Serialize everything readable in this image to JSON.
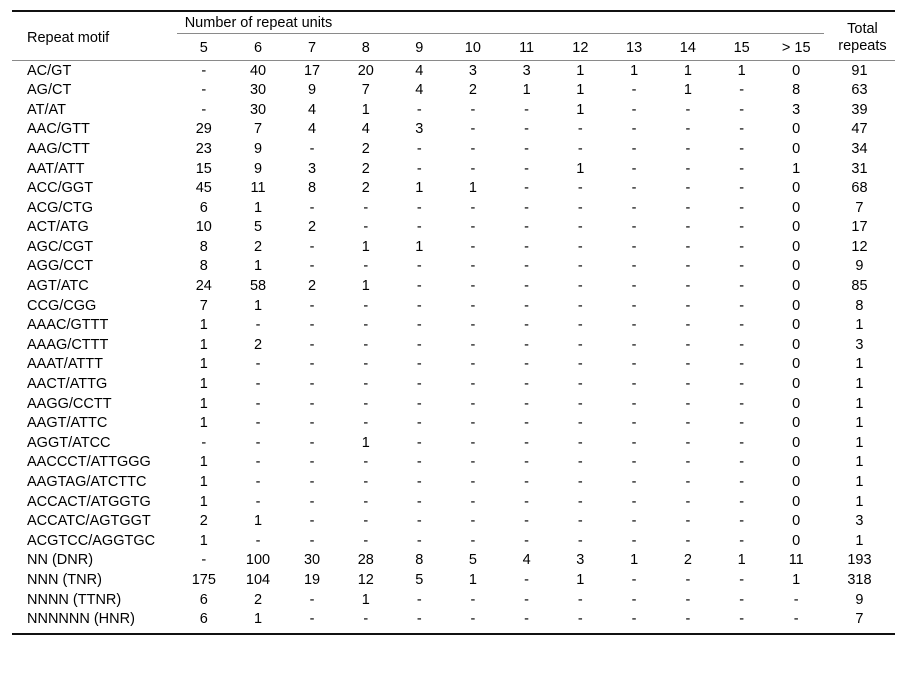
{
  "table": {
    "header": {
      "motif_label": "Repeat motif",
      "span_label": "Number of repeat units",
      "total_label_line1": "Total",
      "total_label_line2": "repeats",
      "unit_columns": [
        "5",
        "6",
        "7",
        "8",
        "9",
        "10",
        "11",
        "12",
        "13",
        "14",
        "15",
        "> 15"
      ]
    },
    "rows": [
      {
        "motif": "AC/GT",
        "values": [
          "-",
          "40",
          "17",
          "20",
          "4",
          "3",
          "3",
          "1",
          "1",
          "1",
          "1",
          "0"
        ],
        "total": "91"
      },
      {
        "motif": "AG/CT",
        "values": [
          "-",
          "30",
          "9",
          "7",
          "4",
          "2",
          "1",
          "1",
          "-",
          "1",
          "-",
          "8"
        ],
        "total": "63"
      },
      {
        "motif": "AT/AT",
        "values": [
          "-",
          "30",
          "4",
          "1",
          "-",
          "-",
          "-",
          "1",
          "-",
          "-",
          "-",
          "3"
        ],
        "total": "39"
      },
      {
        "motif": "AAC/GTT",
        "values": [
          "29",
          "7",
          "4",
          "4",
          "3",
          "-",
          "-",
          "-",
          "-",
          "-",
          "-",
          "0"
        ],
        "total": "47"
      },
      {
        "motif": "AAG/CTT",
        "values": [
          "23",
          "9",
          "-",
          "2",
          "-",
          "-",
          "-",
          "-",
          "-",
          "-",
          "-",
          "0"
        ],
        "total": "34"
      },
      {
        "motif": "AAT/ATT",
        "values": [
          "15",
          "9",
          "3",
          "2",
          "-",
          "-",
          "-",
          "1",
          "-",
          "-",
          "-",
          "1"
        ],
        "total": "31"
      },
      {
        "motif": "ACC/GGT",
        "values": [
          "45",
          "11",
          "8",
          "2",
          "1",
          "1",
          "-",
          "-",
          "-",
          "-",
          "-",
          "0"
        ],
        "total": "68"
      },
      {
        "motif": "ACG/CTG",
        "values": [
          "6",
          "1",
          "-",
          "-",
          "-",
          "-",
          "-",
          "-",
          "-",
          "-",
          "-",
          "0"
        ],
        "total": "7"
      },
      {
        "motif": "ACT/ATG",
        "values": [
          "10",
          "5",
          "2",
          "-",
          "-",
          "-",
          "-",
          "-",
          "-",
          "-",
          "-",
          "0"
        ],
        "total": "17"
      },
      {
        "motif": "AGC/CGT",
        "values": [
          "8",
          "2",
          "-",
          "1",
          "1",
          "-",
          "-",
          "-",
          "-",
          "-",
          "-",
          "0"
        ],
        "total": "12"
      },
      {
        "motif": "AGG/CCT",
        "values": [
          "8",
          "1",
          "-",
          "-",
          "-",
          "-",
          "-",
          "-",
          "-",
          "-",
          "-",
          "0"
        ],
        "total": "9"
      },
      {
        "motif": "AGT/ATC",
        "values": [
          "24",
          "58",
          "2",
          "1",
          "-",
          "-",
          "-",
          "-",
          "-",
          "-",
          "-",
          "0"
        ],
        "total": "85"
      },
      {
        "motif": "CCG/CGG",
        "values": [
          "7",
          "1",
          "-",
          "-",
          "-",
          "-",
          "-",
          "-",
          "-",
          "-",
          "-",
          "0"
        ],
        "total": "8"
      },
      {
        "motif": "AAAC/GTTT",
        "values": [
          "1",
          "-",
          "-",
          "-",
          "-",
          "-",
          "-",
          "-",
          "-",
          "-",
          "-",
          "0"
        ],
        "total": "1"
      },
      {
        "motif": "AAAG/CTTT",
        "values": [
          "1",
          "2",
          "-",
          "-",
          "-",
          "-",
          "-",
          "-",
          "-",
          "-",
          "-",
          "0"
        ],
        "total": "3"
      },
      {
        "motif": "AAAT/ATTT",
        "values": [
          "1",
          "-",
          "-",
          "-",
          "-",
          "-",
          "-",
          "-",
          "-",
          "-",
          "-",
          "0"
        ],
        "total": "1"
      },
      {
        "motif": "AACT/ATTG",
        "values": [
          "1",
          "-",
          "-",
          "-",
          "-",
          "-",
          "-",
          "-",
          "-",
          "-",
          "-",
          "0"
        ],
        "total": "1"
      },
      {
        "motif": "AAGG/CCTT",
        "values": [
          "1",
          "-",
          "-",
          "-",
          "-",
          "-",
          "-",
          "-",
          "-",
          "-",
          "-",
          "0"
        ],
        "total": "1"
      },
      {
        "motif": "AAGT/ATTC",
        "values": [
          "1",
          "-",
          "-",
          "-",
          "-",
          "-",
          "-",
          "-",
          "-",
          "-",
          "-",
          "0"
        ],
        "total": "1"
      },
      {
        "motif": "AGGT/ATCC",
        "values": [
          "-",
          "-",
          "-",
          "1",
          "-",
          "-",
          "-",
          "-",
          "-",
          "-",
          "-",
          "0"
        ],
        "total": "1"
      },
      {
        "motif": "AACCCT/ATTGGG",
        "values": [
          "1",
          "-",
          "-",
          "-",
          "-",
          "-",
          "-",
          "-",
          "-",
          "-",
          "-",
          "0"
        ],
        "total": "1"
      },
      {
        "motif": "AAGTAG/ATCTTC",
        "values": [
          "1",
          "-",
          "-",
          "-",
          "-",
          "-",
          "-",
          "-",
          "-",
          "-",
          "-",
          "0"
        ],
        "total": "1"
      },
      {
        "motif": "ACCACT/ATGGTG",
        "values": [
          "1",
          "-",
          "-",
          "-",
          "-",
          "-",
          "-",
          "-",
          "-",
          "-",
          "-",
          "0"
        ],
        "total": "1"
      },
      {
        "motif": "ACCATC/AGTGGT",
        "values": [
          "2",
          "1",
          "-",
          "-",
          "-",
          "-",
          "-",
          "-",
          "-",
          "-",
          "-",
          "0"
        ],
        "total": "3"
      },
      {
        "motif": "ACGTCC/AGGTGC",
        "values": [
          "1",
          "-",
          "-",
          "-",
          "-",
          "-",
          "-",
          "-",
          "-",
          "-",
          "-",
          "0"
        ],
        "total": "1"
      },
      {
        "motif": "NN (DNR)",
        "values": [
          "-",
          "100",
          "30",
          "28",
          "8",
          "5",
          "4",
          "3",
          "1",
          "2",
          "1",
          "11"
        ],
        "total": "193"
      },
      {
        "motif": "NNN (TNR)",
        "values": [
          "175",
          "104",
          "19",
          "12",
          "5",
          "1",
          "-",
          "1",
          "-",
          "-",
          "-",
          "1"
        ],
        "total": "318"
      },
      {
        "motif": "NNNN (TTNR)",
        "values": [
          "6",
          "2",
          "-",
          "1",
          "-",
          "-",
          "-",
          "-",
          "-",
          "-",
          "-",
          "-"
        ],
        "total": "9"
      },
      {
        "motif": "NNNNNN (HNR)",
        "values": [
          "6",
          "1",
          "-",
          "-",
          "-",
          "-",
          "-",
          "-",
          "-",
          "-",
          "-",
          "-"
        ],
        "total": "7"
      }
    ]
  },
  "chart_data": {
    "type": "table",
    "title": "Number of repeat units",
    "xlabel": "Number of repeat units",
    "ylabel": "Repeat motif",
    "categories": [
      "5",
      "6",
      "7",
      "8",
      "9",
      "10",
      "11",
      "12",
      "13",
      "14",
      "15",
      "> 15"
    ],
    "series": [
      {
        "name": "AC/GT",
        "values": [
          0,
          40,
          17,
          20,
          4,
          3,
          3,
          1,
          1,
          1,
          1,
          0
        ],
        "total": 91
      },
      {
        "name": "AG/CT",
        "values": [
          0,
          30,
          9,
          7,
          4,
          2,
          1,
          1,
          0,
          1,
          0,
          8
        ],
        "total": 63
      },
      {
        "name": "AT/AT",
        "values": [
          0,
          30,
          4,
          1,
          0,
          0,
          0,
          1,
          0,
          0,
          0,
          3
        ],
        "total": 39
      },
      {
        "name": "AAC/GTT",
        "values": [
          29,
          7,
          4,
          4,
          3,
          0,
          0,
          0,
          0,
          0,
          0,
          0
        ],
        "total": 47
      },
      {
        "name": "AAG/CTT",
        "values": [
          23,
          9,
          0,
          2,
          0,
          0,
          0,
          0,
          0,
          0,
          0,
          0
        ],
        "total": 34
      },
      {
        "name": "AAT/ATT",
        "values": [
          15,
          9,
          3,
          2,
          0,
          0,
          0,
          1,
          0,
          0,
          0,
          1
        ],
        "total": 31
      },
      {
        "name": "ACC/GGT",
        "values": [
          45,
          11,
          8,
          2,
          1,
          1,
          0,
          0,
          0,
          0,
          0,
          0
        ],
        "total": 68
      },
      {
        "name": "ACG/CTG",
        "values": [
          6,
          1,
          0,
          0,
          0,
          0,
          0,
          0,
          0,
          0,
          0,
          0
        ],
        "total": 7
      },
      {
        "name": "ACT/ATG",
        "values": [
          10,
          5,
          2,
          0,
          0,
          0,
          0,
          0,
          0,
          0,
          0,
          0
        ],
        "total": 17
      },
      {
        "name": "AGC/CGT",
        "values": [
          8,
          2,
          0,
          1,
          1,
          0,
          0,
          0,
          0,
          0,
          0,
          0
        ],
        "total": 12
      },
      {
        "name": "AGG/CCT",
        "values": [
          8,
          1,
          0,
          0,
          0,
          0,
          0,
          0,
          0,
          0,
          0,
          0
        ],
        "total": 9
      },
      {
        "name": "AGT/ATC",
        "values": [
          24,
          58,
          2,
          1,
          0,
          0,
          0,
          0,
          0,
          0,
          0,
          0
        ],
        "total": 85
      },
      {
        "name": "CCG/CGG",
        "values": [
          7,
          1,
          0,
          0,
          0,
          0,
          0,
          0,
          0,
          0,
          0,
          0
        ],
        "total": 8
      },
      {
        "name": "AAAC/GTTT",
        "values": [
          1,
          0,
          0,
          0,
          0,
          0,
          0,
          0,
          0,
          0,
          0,
          0
        ],
        "total": 1
      },
      {
        "name": "AAAG/CTTT",
        "values": [
          1,
          2,
          0,
          0,
          0,
          0,
          0,
          0,
          0,
          0,
          0,
          0
        ],
        "total": 3
      },
      {
        "name": "AAAT/ATTT",
        "values": [
          1,
          0,
          0,
          0,
          0,
          0,
          0,
          0,
          0,
          0,
          0,
          0
        ],
        "total": 1
      },
      {
        "name": "AACT/ATTG",
        "values": [
          1,
          0,
          0,
          0,
          0,
          0,
          0,
          0,
          0,
          0,
          0,
          0
        ],
        "total": 1
      },
      {
        "name": "AAGG/CCTT",
        "values": [
          1,
          0,
          0,
          0,
          0,
          0,
          0,
          0,
          0,
          0,
          0,
          0
        ],
        "total": 1
      },
      {
        "name": "AAGT/ATTC",
        "values": [
          1,
          0,
          0,
          0,
          0,
          0,
          0,
          0,
          0,
          0,
          0,
          0
        ],
        "total": 1
      },
      {
        "name": "AGGT/ATCC",
        "values": [
          0,
          0,
          0,
          1,
          0,
          0,
          0,
          0,
          0,
          0,
          0,
          0
        ],
        "total": 1
      },
      {
        "name": "AACCCT/ATTGGG",
        "values": [
          1,
          0,
          0,
          0,
          0,
          0,
          0,
          0,
          0,
          0,
          0,
          0
        ],
        "total": 1
      },
      {
        "name": "AAGTAG/ATCTTC",
        "values": [
          1,
          0,
          0,
          0,
          0,
          0,
          0,
          0,
          0,
          0,
          0,
          0
        ],
        "total": 1
      },
      {
        "name": "ACCACT/ATGGTG",
        "values": [
          1,
          0,
          0,
          0,
          0,
          0,
          0,
          0,
          0,
          0,
          0,
          0
        ],
        "total": 1
      },
      {
        "name": "ACCATC/AGTGGT",
        "values": [
          2,
          1,
          0,
          0,
          0,
          0,
          0,
          0,
          0,
          0,
          0,
          0
        ],
        "total": 3
      },
      {
        "name": "ACGTCC/AGGTGC",
        "values": [
          1,
          0,
          0,
          0,
          0,
          0,
          0,
          0,
          0,
          0,
          0,
          0
        ],
        "total": 1
      },
      {
        "name": "NN (DNR)",
        "values": [
          0,
          100,
          30,
          28,
          8,
          5,
          4,
          3,
          1,
          2,
          1,
          11
        ],
        "total": 193
      },
      {
        "name": "NNN (TNR)",
        "values": [
          175,
          104,
          19,
          12,
          5,
          1,
          0,
          1,
          0,
          0,
          0,
          1
        ],
        "total": 318
      },
      {
        "name": "NNNN (TTNR)",
        "values": [
          6,
          2,
          0,
          1,
          0,
          0,
          0,
          0,
          0,
          0,
          0,
          0
        ],
        "total": 9
      },
      {
        "name": "NNNNNN (HNR)",
        "values": [
          6,
          1,
          0,
          0,
          0,
          0,
          0,
          0,
          0,
          0,
          0,
          0
        ],
        "total": 7
      }
    ]
  }
}
